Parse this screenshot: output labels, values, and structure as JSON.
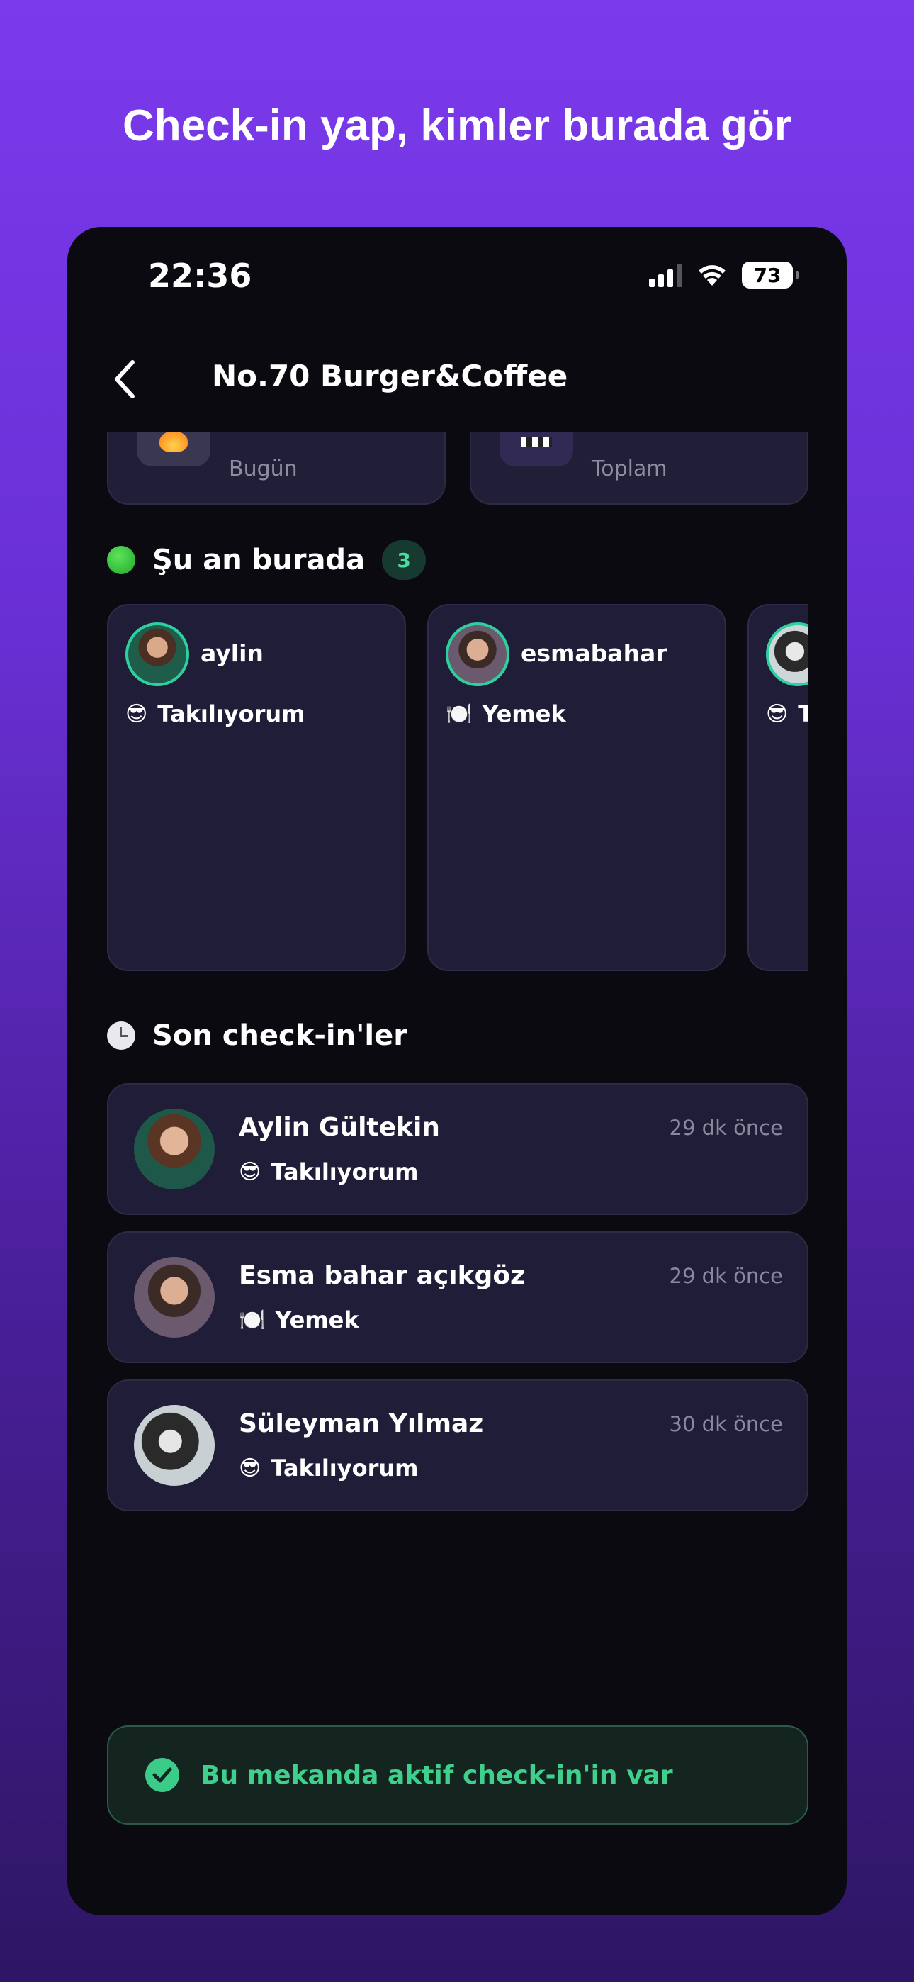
{
  "headline": "Check-in yap, kimler burada gör",
  "status_bar": {
    "time": "22:36",
    "battery": "73"
  },
  "header": {
    "title": "No.70 Burger&Coffee"
  },
  "stats": [
    {
      "label": "Bugün",
      "icon": "fire-icon",
      "icon_bg": "#3a3850"
    },
    {
      "label": "Toplam",
      "icon": "flag-icon",
      "icon_bg": "#302a55"
    }
  ],
  "here_now": {
    "title": "Şu an burada",
    "count": "3",
    "people": [
      {
        "name": "aylin",
        "mood_emoji": "😎",
        "mood": "Takılıyorum"
      },
      {
        "name": "esmabahar",
        "mood_emoji": "🍽️",
        "mood": "Yemek"
      },
      {
        "name": "",
        "mood_emoji": "😎",
        "mood": "T"
      }
    ]
  },
  "recent": {
    "title": "Son check-in'ler",
    "rows": [
      {
        "name": "Aylin Gültekin",
        "mood_emoji": "😎",
        "mood": "Takılıyorum",
        "time": "29 dk önce"
      },
      {
        "name": "Esma bahar açıkgöz",
        "mood_emoji": "🍽️",
        "mood": "Yemek",
        "time": "29 dk önce"
      },
      {
        "name": "Süleyman Yılmaz",
        "mood_emoji": "😎",
        "mood": "Takılıyorum",
        "time": "30 dk önce"
      }
    ]
  },
  "banner": {
    "text": "Bu mekanda aktif check-in'in var"
  },
  "colors": {
    "accent_green": "#3fd08e",
    "card_bg": "#1f1d37",
    "phone_bg": "#0b0a10",
    "bg_purple": "#7b3aec"
  }
}
